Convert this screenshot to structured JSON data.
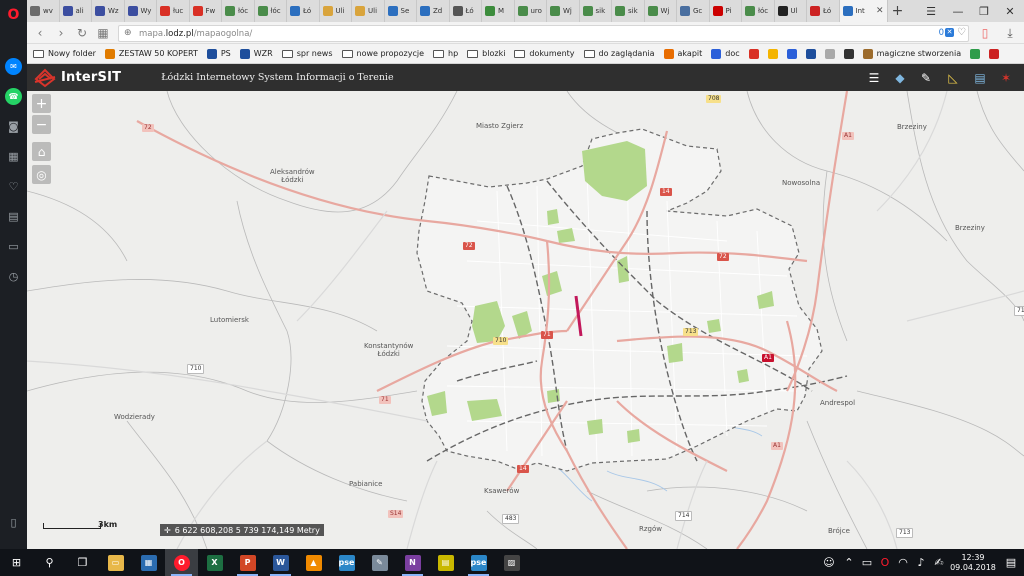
{
  "browser": {
    "tabs": [
      {
        "label": "wv",
        "color": "#6b6b6b"
      },
      {
        "label": "ali",
        "color": "#3c4ea0"
      },
      {
        "label": "Wz",
        "color": "#3c4ea0"
      },
      {
        "label": "Wy",
        "color": "#3c4ea0"
      },
      {
        "label": "łuc",
        "color": "#d93025"
      },
      {
        "label": "Fw",
        "color": "#d93025"
      },
      {
        "label": "łóc",
        "color": "#4a8c4a"
      },
      {
        "label": "łóc",
        "color": "#4a8c4a"
      },
      {
        "label": "Łó",
        "color": "#2c6fbf"
      },
      {
        "label": "Uli",
        "color": "#d9a43c"
      },
      {
        "label": "Uli",
        "color": "#d9a43c"
      },
      {
        "label": "Se",
        "color": "#2c6fbf"
      },
      {
        "label": "Zd",
        "color": "#2c6fbf"
      },
      {
        "label": "Łó",
        "color": "#555555"
      },
      {
        "label": "M",
        "color": "#3c8c3c"
      },
      {
        "label": "uro",
        "color": "#4a8c4a"
      },
      {
        "label": "Wj",
        "color": "#4a8c4a"
      },
      {
        "label": "sik",
        "color": "#4a8c4a"
      },
      {
        "label": "sik",
        "color": "#4a8c4a"
      },
      {
        "label": "Wj",
        "color": "#4a8c4a"
      },
      {
        "label": "Gc",
        "color": "#4a6fa0"
      },
      {
        "label": "Pi",
        "color": "#cc0000"
      },
      {
        "label": "łóc",
        "color": "#4a8c4a"
      },
      {
        "label": "Ul",
        "color": "#222222"
      },
      {
        "label": "Łó",
        "color": "#cc2222"
      },
      {
        "label": "Int",
        "color": "#2c6fbf",
        "active": true
      }
    ],
    "url_scheme_host": "mapa.",
    "url_domain": "lodz.pl",
    "url_path": "/mapaogolna/",
    "badge_count": "0",
    "bookmarks": [
      {
        "label": "Nowy folder",
        "kind": "folder"
      },
      {
        "label": "ZESTAW 50 KOPERT",
        "kind": "icon",
        "color": "#e07b00"
      },
      {
        "label": "PS",
        "kind": "icon",
        "color": "#1e4e9c"
      },
      {
        "label": "WZR",
        "kind": "icon",
        "color": "#1e4e9c"
      },
      {
        "label": "spr news",
        "kind": "folder"
      },
      {
        "label": "nowe propozycje",
        "kind": "folder"
      },
      {
        "label": "hp",
        "kind": "folder"
      },
      {
        "label": "blozki",
        "kind": "folder"
      },
      {
        "label": "dokumenty",
        "kind": "folder"
      },
      {
        "label": "do zaglądania",
        "kind": "folder"
      },
      {
        "label": "akapit",
        "kind": "icon",
        "color": "#e86c00"
      },
      {
        "label": "doc",
        "kind": "icon",
        "color": "#2b5fd9"
      },
      {
        "label": "",
        "kind": "icon",
        "color": "#d93025"
      },
      {
        "label": "",
        "kind": "icon",
        "color": "#f4b400"
      },
      {
        "label": "",
        "kind": "icon",
        "color": "#2b5fd9"
      },
      {
        "label": "",
        "kind": "icon",
        "color": "#1e4e9c"
      },
      {
        "label": "",
        "kind": "icon",
        "color": "#aaaaaa"
      },
      {
        "label": "",
        "kind": "icon",
        "color": "#333333"
      },
      {
        "label": "magiczne stworzenia",
        "kind": "icon",
        "color": "#9c6b2c"
      },
      {
        "label": "",
        "kind": "icon",
        "color": "#2e9c4a"
      },
      {
        "label": "",
        "kind": "icon",
        "color": "#cc2222"
      }
    ]
  },
  "app": {
    "title": "InterSIT",
    "subtitle": "Łódzki Internetowy System Informacji o Terenie",
    "accent": "#d9342b"
  },
  "map": {
    "labels": {
      "miasto_zgierz": "Miasto Zgierz",
      "brzeziny": "Brzeziny",
      "aleksandrow": "Aleksandrów\nŁódzki",
      "nowosolna": "Nowosolna",
      "brzeziny2": "Brzeziny",
      "lutomiersk": "Lutomiersk",
      "konstantynow": "Konstantynów\nŁódzki",
      "wodzierady": "Wodzierady",
      "andrespol": "Andrespol",
      "pabianice": "Pabianice",
      "ksawerow": "Ksawerów",
      "rzgow": "Rzgów",
      "brojce": "Brójce"
    },
    "road_shields": {
      "r708": "708",
      "r72a": "72",
      "r72b": "72",
      "r72c": "72",
      "r14a": "14",
      "r14b": "14",
      "r713": "713",
      "r710": "710",
      "r710b": "710",
      "r71": "71",
      "r71b": "71",
      "rA1": "A1",
      "rA1b": "A1",
      "rA1c": "A1",
      "rS14": "S14",
      "r483": "483",
      "r714": "714",
      "r713b": "713",
      "r71c": "71"
    },
    "scale_label": "3km",
    "coordinates": "6 622 608,208 5 739 174,149 Metry"
  },
  "taskbar": {
    "time": "12:39",
    "date": "09.04.2018"
  }
}
